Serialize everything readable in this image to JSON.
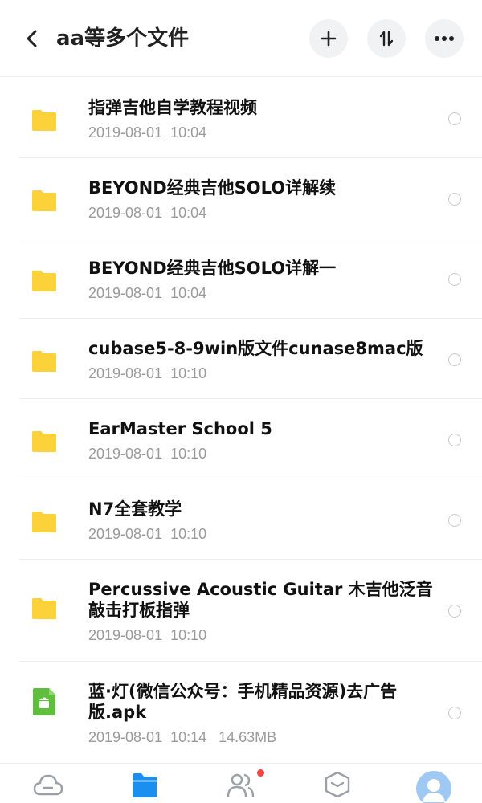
{
  "header": {
    "title": "aa等多个文件",
    "back_icon": "chevron-left-icon",
    "add_icon": "plus-icon",
    "sort_icon": "sort-icon",
    "more_icon": "more-horizontal-icon"
  },
  "files": [
    {
      "name": "指弹吉他自学教程视频",
      "date": "2019-08-01  10:04",
      "type": "folder"
    },
    {
      "name": "BEYOND经典吉他SOLO详解续",
      "date": "2019-08-01  10:04",
      "type": "folder"
    },
    {
      "name": "BEYOND经典吉他SOLO详解一",
      "date": "2019-08-01  10:04",
      "type": "folder"
    },
    {
      "name": "cubase5-8-9win版文件cunase8mac版",
      "date": "2019-08-01  10:10",
      "type": "folder"
    },
    {
      "name": "EarMaster School 5",
      "date": "2019-08-01  10:10",
      "type": "folder"
    },
    {
      "name": "N7全套教学",
      "date": "2019-08-01  10:10",
      "type": "folder"
    },
    {
      "name": "Percussive Acoustic Guitar 木吉他泛音敲击打板指弹",
      "date": "2019-08-01  10:10",
      "type": "folder"
    },
    {
      "name": "蓝·灯(微信公众号：手机精品资源)去广告版.apk",
      "date": "2019-08-01  10:14   14.63MB",
      "type": "apk"
    }
  ],
  "colors": {
    "folder": "#fcd23a",
    "apk": "#5fbf3c",
    "accent": "#1b8ff0",
    "badge": "#f0463c"
  },
  "tabbar": {
    "tabs": [
      "cloud-icon",
      "files-icon",
      "contacts-icon",
      "box-icon",
      "avatar-icon"
    ],
    "active": 1
  }
}
